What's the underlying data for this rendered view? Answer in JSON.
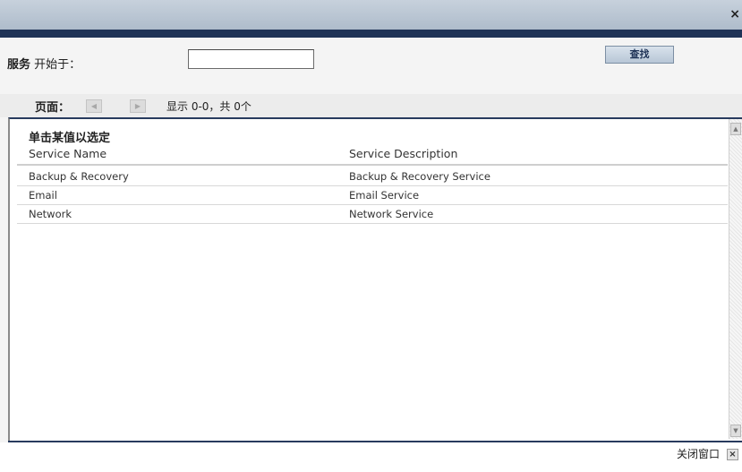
{
  "titlebar": {
    "close_glyph": "×"
  },
  "search": {
    "label_bold": "服务",
    "label_rest": " 开始于：",
    "input_value": "",
    "find_label": "查找"
  },
  "pager": {
    "label": "页面：",
    "prev_icon": "arrow-left-icon",
    "next_icon": "arrow-right-icon",
    "status": "显示 0-0，共 0个"
  },
  "content": {
    "title": "单击某值以选定",
    "columns": [
      "Service Name",
      "Service Description"
    ],
    "rows": [
      {
        "name": "Backup & Recovery",
        "description": "Backup & Recovery Service"
      },
      {
        "name": "Email",
        "description": "Email Service"
      },
      {
        "name": "Network",
        "description": "Network Service"
      }
    ]
  },
  "footer": {
    "close_label": "关闭窗口",
    "close_icon": "close-icon"
  },
  "colors": {
    "navy": "#1f3357",
    "titlebar": "#aebccb",
    "panel": "#f4f4f4"
  }
}
